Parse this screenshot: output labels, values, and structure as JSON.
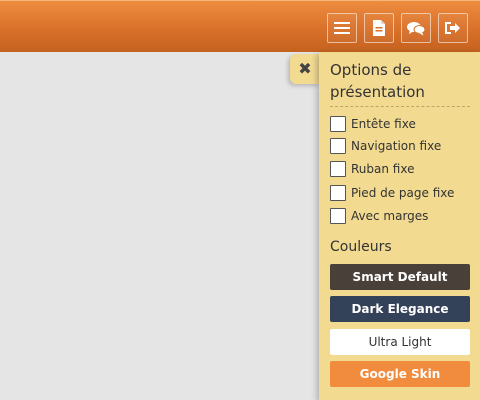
{
  "topbar": {
    "buttons": [
      {
        "icon": "menu-icon"
      },
      {
        "icon": "document-icon"
      },
      {
        "icon": "chat-icon"
      },
      {
        "icon": "logout-icon"
      }
    ],
    "colors": {
      "bar": "#d9712a",
      "button_border": "#ffffff"
    }
  },
  "panel": {
    "close_glyph": "✖",
    "title": "Options de présentation",
    "options": [
      {
        "label": "Entête fixe",
        "checked": false
      },
      {
        "label": "Navigation fixe",
        "checked": false
      },
      {
        "label": "Ruban fixe",
        "checked": false
      },
      {
        "label": "Pied de page fixe",
        "checked": false
      },
      {
        "label": "Avec marges",
        "checked": false
      }
    ],
    "colors_heading": "Couleurs",
    "skins": [
      {
        "label": "Smart Default",
        "color": "#4a403a"
      },
      {
        "label": "Dark Elegance",
        "color": "#344259"
      },
      {
        "label": "Ultra Light",
        "color": "#ffffff"
      },
      {
        "label": "Google Skin",
        "color": "#f18b3d"
      }
    ],
    "background": "#f2da91"
  }
}
